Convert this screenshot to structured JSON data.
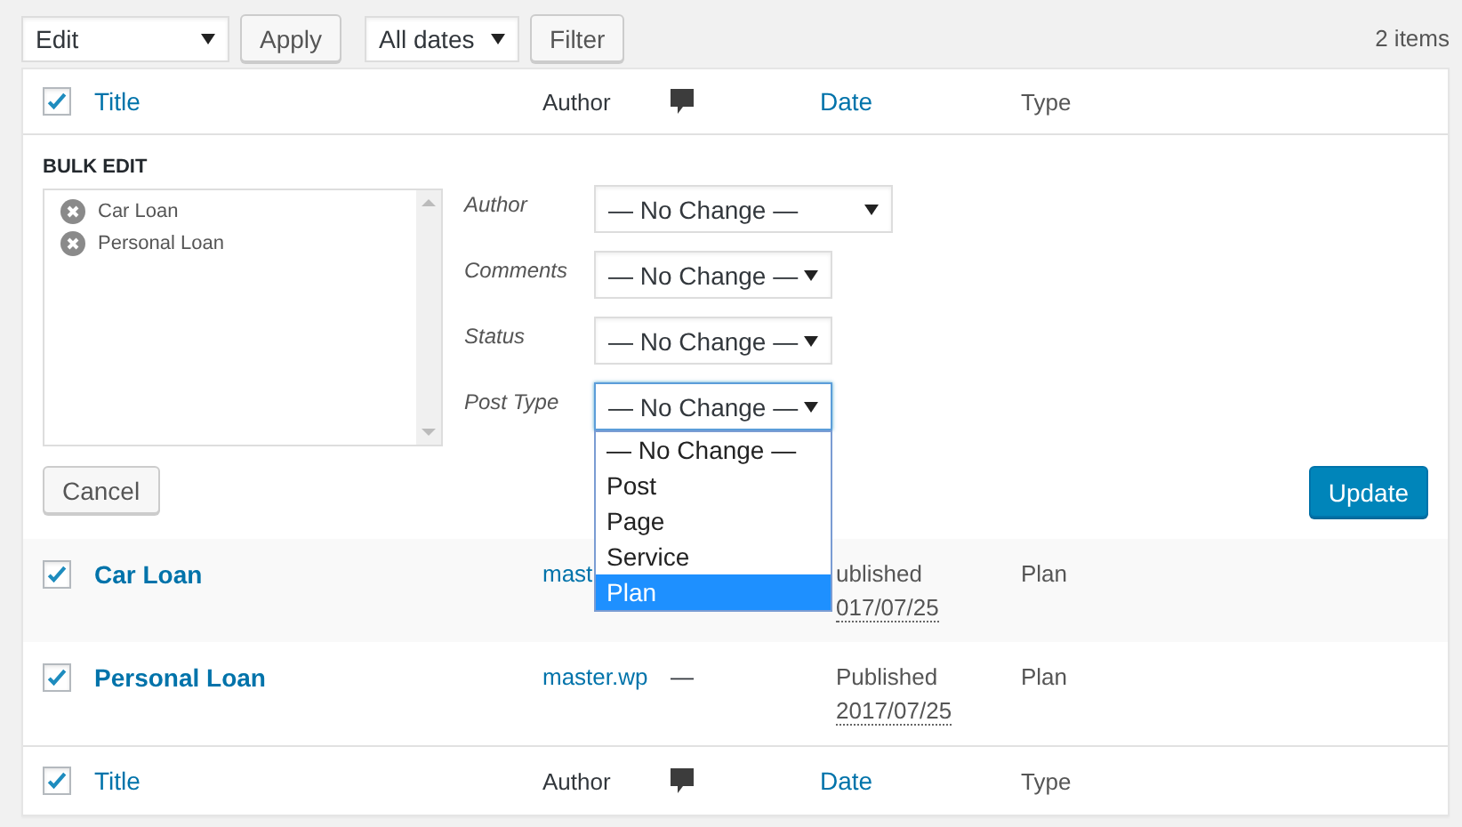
{
  "toolbar": {
    "bulk_action": "Edit",
    "apply": "Apply",
    "date_filter": "All dates",
    "filter": "Filter",
    "count": "2 items"
  },
  "header": {
    "checked": true,
    "title": "Title",
    "author": "Author",
    "date": "Date",
    "type": "Type"
  },
  "bulk_edit": {
    "heading": "BULK EDIT",
    "items": [
      "Car Loan",
      "Personal Loan"
    ],
    "fields": [
      {
        "label": "Author",
        "value": "— No Change —",
        "open": false
      },
      {
        "label": "Comments",
        "value": "— No Change —",
        "open": false
      },
      {
        "label": "Status",
        "value": "— No Change —",
        "open": false
      },
      {
        "label": "Post Type",
        "value": "— No Change —",
        "open": true,
        "options": [
          {
            "label": "— No Change —",
            "highlighted": false
          },
          {
            "label": "Post",
            "highlighted": false
          },
          {
            "label": "Page",
            "highlighted": false
          },
          {
            "label": "Service",
            "highlighted": false
          },
          {
            "label": "Plan",
            "highlighted": true
          }
        ]
      }
    ],
    "cancel": "Cancel",
    "update": "Update"
  },
  "rows": [
    {
      "checked": true,
      "title": "Car Loan",
      "author": "mast",
      "status": "ublished",
      "date": "017/07/25",
      "type": "Plan"
    },
    {
      "checked": true,
      "title": "Personal Loan",
      "author": "master.wp",
      "comments": "—",
      "status": "Published",
      "date": "2017/07/25",
      "type": "Plan"
    }
  ],
  "footer": {
    "checked": true,
    "title": "Title",
    "author": "Author",
    "date": "Date",
    "type": "Type"
  }
}
